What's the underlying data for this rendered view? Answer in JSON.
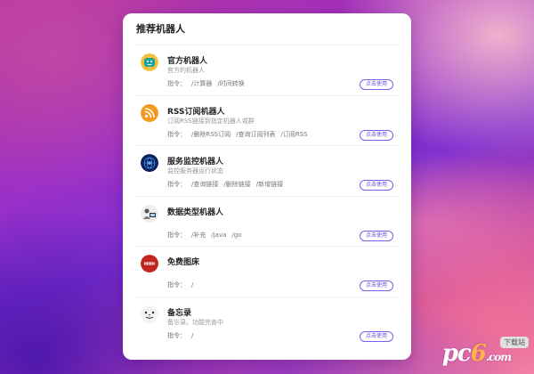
{
  "panel": {
    "title": "推荐机器人"
  },
  "bots": [
    {
      "name": "官方机器人",
      "desc": "官方的机器人",
      "cmd_label": "指令：",
      "cmds": [
        "/计算器",
        "/时间转换"
      ],
      "button": "点击使用",
      "icon": "robot-face-icon"
    },
    {
      "name": "RSS订阅机器人",
      "desc": "订阅RSS链接到指定机器人或群",
      "cmd_label": "指令：",
      "cmds": [
        "/删除RSS订阅",
        "/查询订阅列表",
        "/订阅RSS"
      ],
      "button": "点击使用",
      "icon": "rss-icon"
    },
    {
      "name": "服务监控机器人",
      "desc": "监控服务器运行状态",
      "cmd_label": "指令：",
      "cmds": [
        "/查询链接",
        "/删除链接",
        "/新增链接"
      ],
      "button": "点击使用",
      "icon": "globe-icon"
    },
    {
      "name": "数据类型机器人",
      "desc": "",
      "cmd_label": "指令：",
      "cmds": [
        "/补充",
        "/java",
        "/go"
      ],
      "button": "点击使用",
      "icon": "person-computer-icon"
    },
    {
      "name": "免费图床",
      "desc": "",
      "cmd_label": "指令：",
      "cmds": [
        "/"
      ],
      "button": "点击使用",
      "icon": "image-host-icon"
    },
    {
      "name": "备忘录",
      "desc": "备忘录。功能完善中",
      "cmd_label": "指令：",
      "cmds": [
        "/"
      ],
      "button": "点击使用",
      "icon": "memo-icon"
    }
  ],
  "watermark": {
    "text": "下载站",
    "logo_a": "pc",
    "logo_b": "6",
    "logo_c": ".com"
  },
  "colors": {
    "accent": "#6a4be6",
    "panel_bg": "#ffffff"
  }
}
